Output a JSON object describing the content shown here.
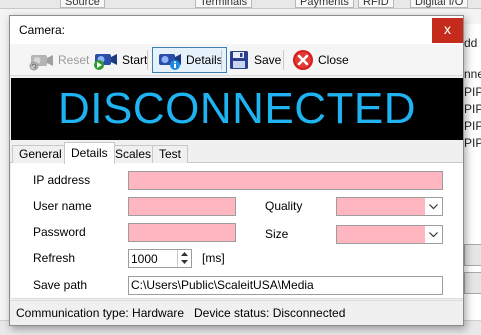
{
  "background": {
    "tabs": [
      "Source",
      "Terminals",
      "Payments",
      "RFID",
      "Digital I/O"
    ],
    "right_header": "dd",
    "right_items": [
      "nne",
      "PIP",
      "PIP",
      "PIP",
      "PIP"
    ]
  },
  "dialog": {
    "title": "Camera:",
    "close_glyph": "x"
  },
  "toolbar": {
    "reset_label": "Reset",
    "start_label": "Start",
    "details_label": "Details",
    "save_label": "Save",
    "close_label": "Close"
  },
  "status_banner": {
    "text": "DISCONNECTED",
    "color": "#1fb3f2"
  },
  "tabs": [
    {
      "label": "General"
    },
    {
      "label": "Details"
    },
    {
      "label": "Scales"
    },
    {
      "label": "Test"
    }
  ],
  "form": {
    "ip_label": "IP address",
    "ip_value": "",
    "user_label": "User name",
    "user_value": "",
    "password_label": "Password",
    "password_value": "",
    "quality_label": "Quality",
    "quality_value": "",
    "size_label": "Size",
    "size_value": "",
    "refresh_label": "Refresh",
    "refresh_value": "1000",
    "refresh_unit": "[ms]",
    "savepath_label": "Save path",
    "savepath_value": "C:\\Users\\Public\\ScaleitUSA\\Media"
  },
  "statusbar": {
    "communication": "Communication type: Hardware",
    "device": "Device status: Disconnected"
  },
  "colors": {
    "invalid_field": "#ffb6c1",
    "close_button": "#c42b1c"
  }
}
